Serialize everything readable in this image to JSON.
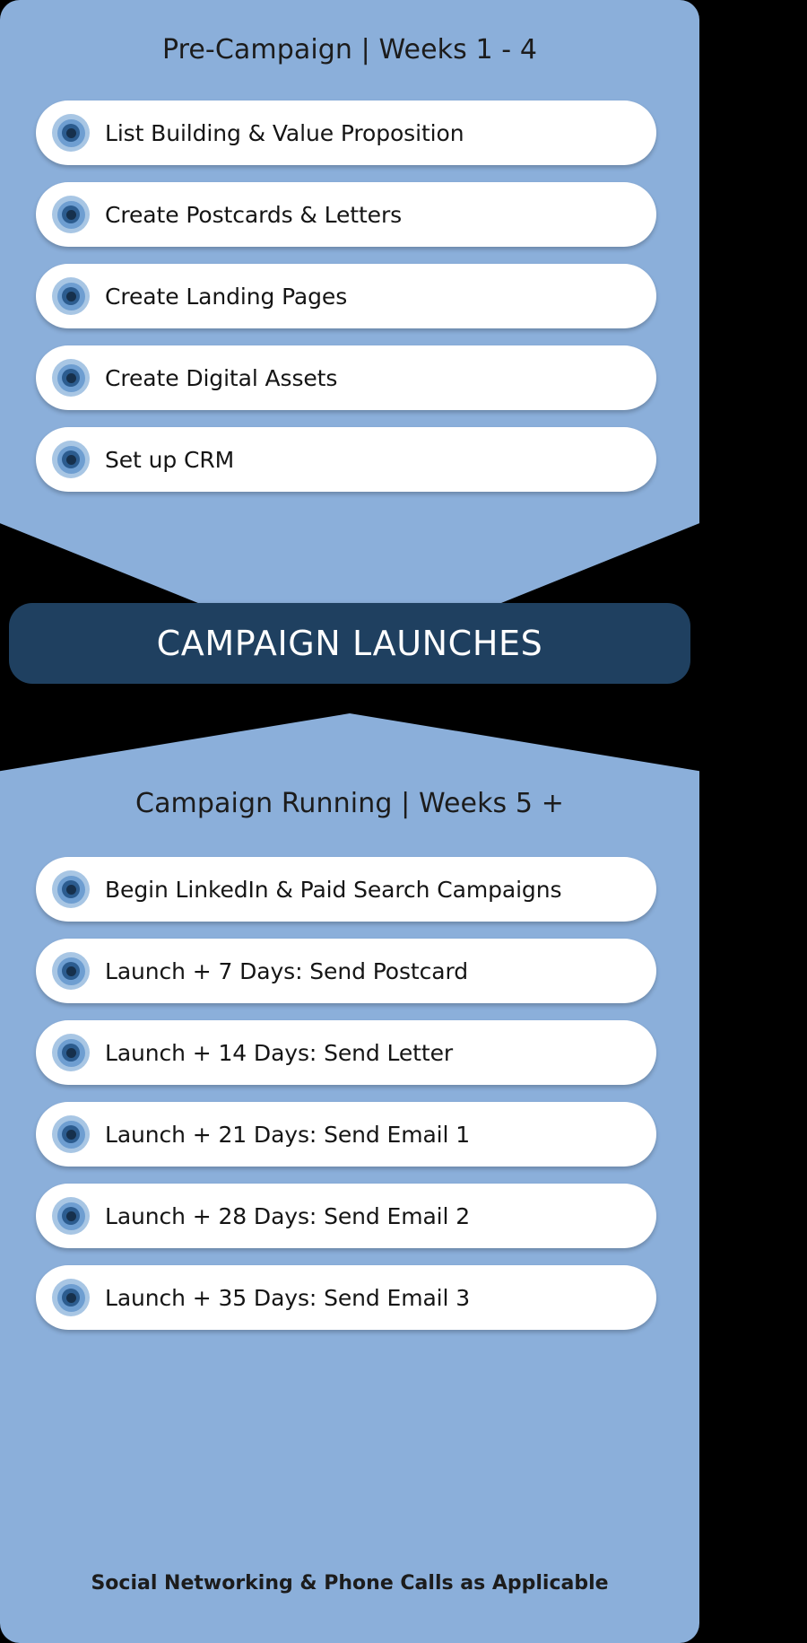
{
  "colors": {
    "background": "#000000",
    "panel_blue": "#8BAFDA",
    "banner_navy": "#1F4060",
    "pill_white": "#FFFFFF",
    "text_dark": "#151515",
    "text_light": "#FFFFFF",
    "icon_outer": "#A8C6E4",
    "icon_mid": "#6E9ED1",
    "icon_inner": "#2C5C8F",
    "icon_core": "#16304C"
  },
  "pre_campaign": {
    "title": "Pre-Campaign | Weeks 1 - 4",
    "items": [
      {
        "label": "List Building & Value Proposition",
        "icon": "bullseye-icon"
      },
      {
        "label": "Create Postcards & Letters",
        "icon": "bullseye-icon"
      },
      {
        "label": "Create Landing Pages",
        "icon": "bullseye-icon"
      },
      {
        "label": "Create Digital Assets",
        "icon": "bullseye-icon"
      },
      {
        "label": "Set up CRM",
        "icon": "bullseye-icon"
      }
    ]
  },
  "launch_banner": {
    "label": "CAMPAIGN LAUNCHES"
  },
  "campaign_running": {
    "title": "Campaign Running | Weeks 5 +",
    "items": [
      {
        "label": "Begin LinkedIn & Paid Search Campaigns",
        "icon": "bullseye-icon"
      },
      {
        "label": "Launch + 7 Days: Send Postcard",
        "icon": "bullseye-icon"
      },
      {
        "label": "Launch + 14 Days: Send Letter",
        "icon": "bullseye-icon"
      },
      {
        "label": "Launch + 21 Days: Send Email 1",
        "icon": "bullseye-icon"
      },
      {
        "label": "Launch + 28 Days: Send Email 2",
        "icon": "bullseye-icon"
      },
      {
        "label": "Launch + 35 Days: Send Email 3",
        "icon": "bullseye-icon"
      }
    ],
    "footer_note": "Social Networking & Phone Calls as Applicable"
  }
}
